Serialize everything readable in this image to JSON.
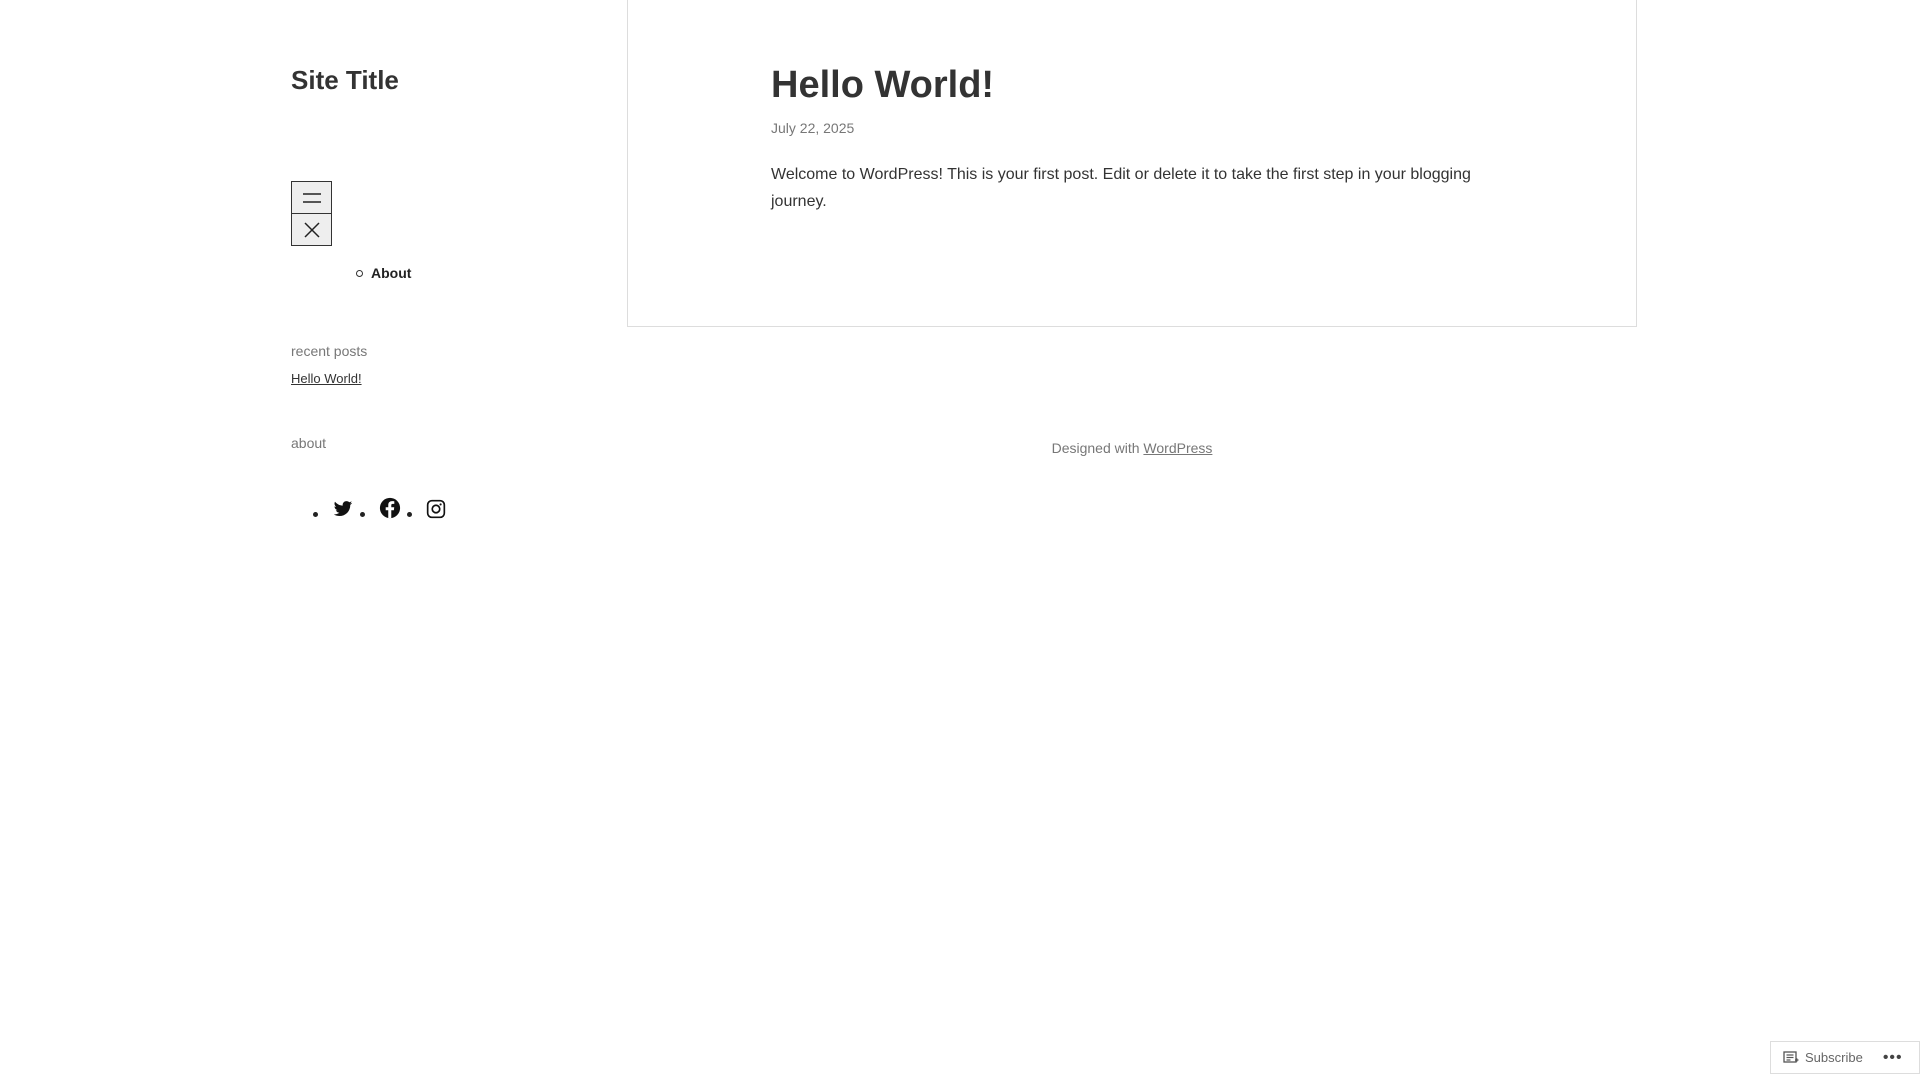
{
  "site": {
    "title": "Site Title"
  },
  "nav": {
    "items": [
      {
        "label": "About"
      }
    ]
  },
  "widgets": {
    "recent_posts_title": "recent posts",
    "recent_posts": [
      {
        "label": "Hello World!"
      }
    ],
    "about_title": "about",
    "social_icons": [
      "twitter-icon",
      "facebook-icon",
      "instagram-icon"
    ]
  },
  "post": {
    "title": "Hello World!",
    "date": "July 22, 2025",
    "body": "Welcome to WordPress! This is your first post. Edit or delete it to take the first step in your blogging journey."
  },
  "footer": {
    "prefix": "Designed with",
    "link_label": "WordPress"
  },
  "subscribe_bar": {
    "subscribe_label": "Subscribe",
    "more_label": "•••"
  }
}
